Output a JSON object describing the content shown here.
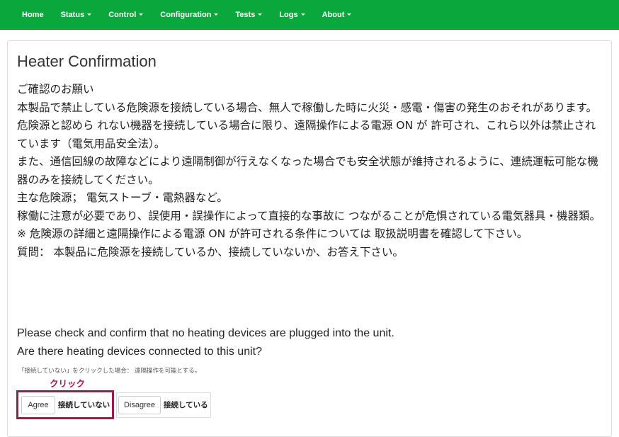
{
  "navbar": {
    "items": [
      {
        "label": "Home"
      },
      {
        "label": "Status"
      },
      {
        "label": "Control"
      },
      {
        "label": "Configuration"
      },
      {
        "label": "Tests"
      },
      {
        "label": "Logs"
      },
      {
        "label": "About"
      }
    ],
    "background": "#0aa83c"
  },
  "page": {
    "title": "Heater Confirmation",
    "japanese_lines": [
      "ご確認のお願い",
      "本製品で禁止している危険源を接続している場合、無人で稼働した時に火災・感電・傷害の発生のおそれがあります。",
      "危険源と認めら れない機器を接続している場合に限り、遠隔操作による電源 ON が 許可され、これら以外は禁止されています（電気用品安全法）。",
      "また、通信回線の故障などにより遠隔制御が行えなくなった場合でも安全状態が維持されるように、連続運転可能な機器のみを接続してください。",
      "主な危険源； 電気ストーブ・電熱器など。",
      "稼働に注意が必要であり、誤使用・誤操作によって直接的な事故に つながることが危惧されている電気器具・機器類。",
      "※ 危険源の詳細と遠隔操作による電源 ON が許可される条件については 取扱説明書を確認して下さい。",
      "質問： 本製品に危険源を接続しているか、接続していないか、お答え下さい。"
    ],
    "english_lines": [
      "Please check and confirm that no heating devices are plugged into the unit.",
      "Are there heating devices connected to this unit?"
    ],
    "note": "「接続していない」をクリックした場合： 遠隔操作を可能とする。",
    "click_label": "クリック",
    "agree_button": "Agree",
    "agree_caption": "接続していない",
    "disagree_button": "Disagree",
    "disagree_caption": "接続している",
    "highlight_color": "#a3164c"
  }
}
